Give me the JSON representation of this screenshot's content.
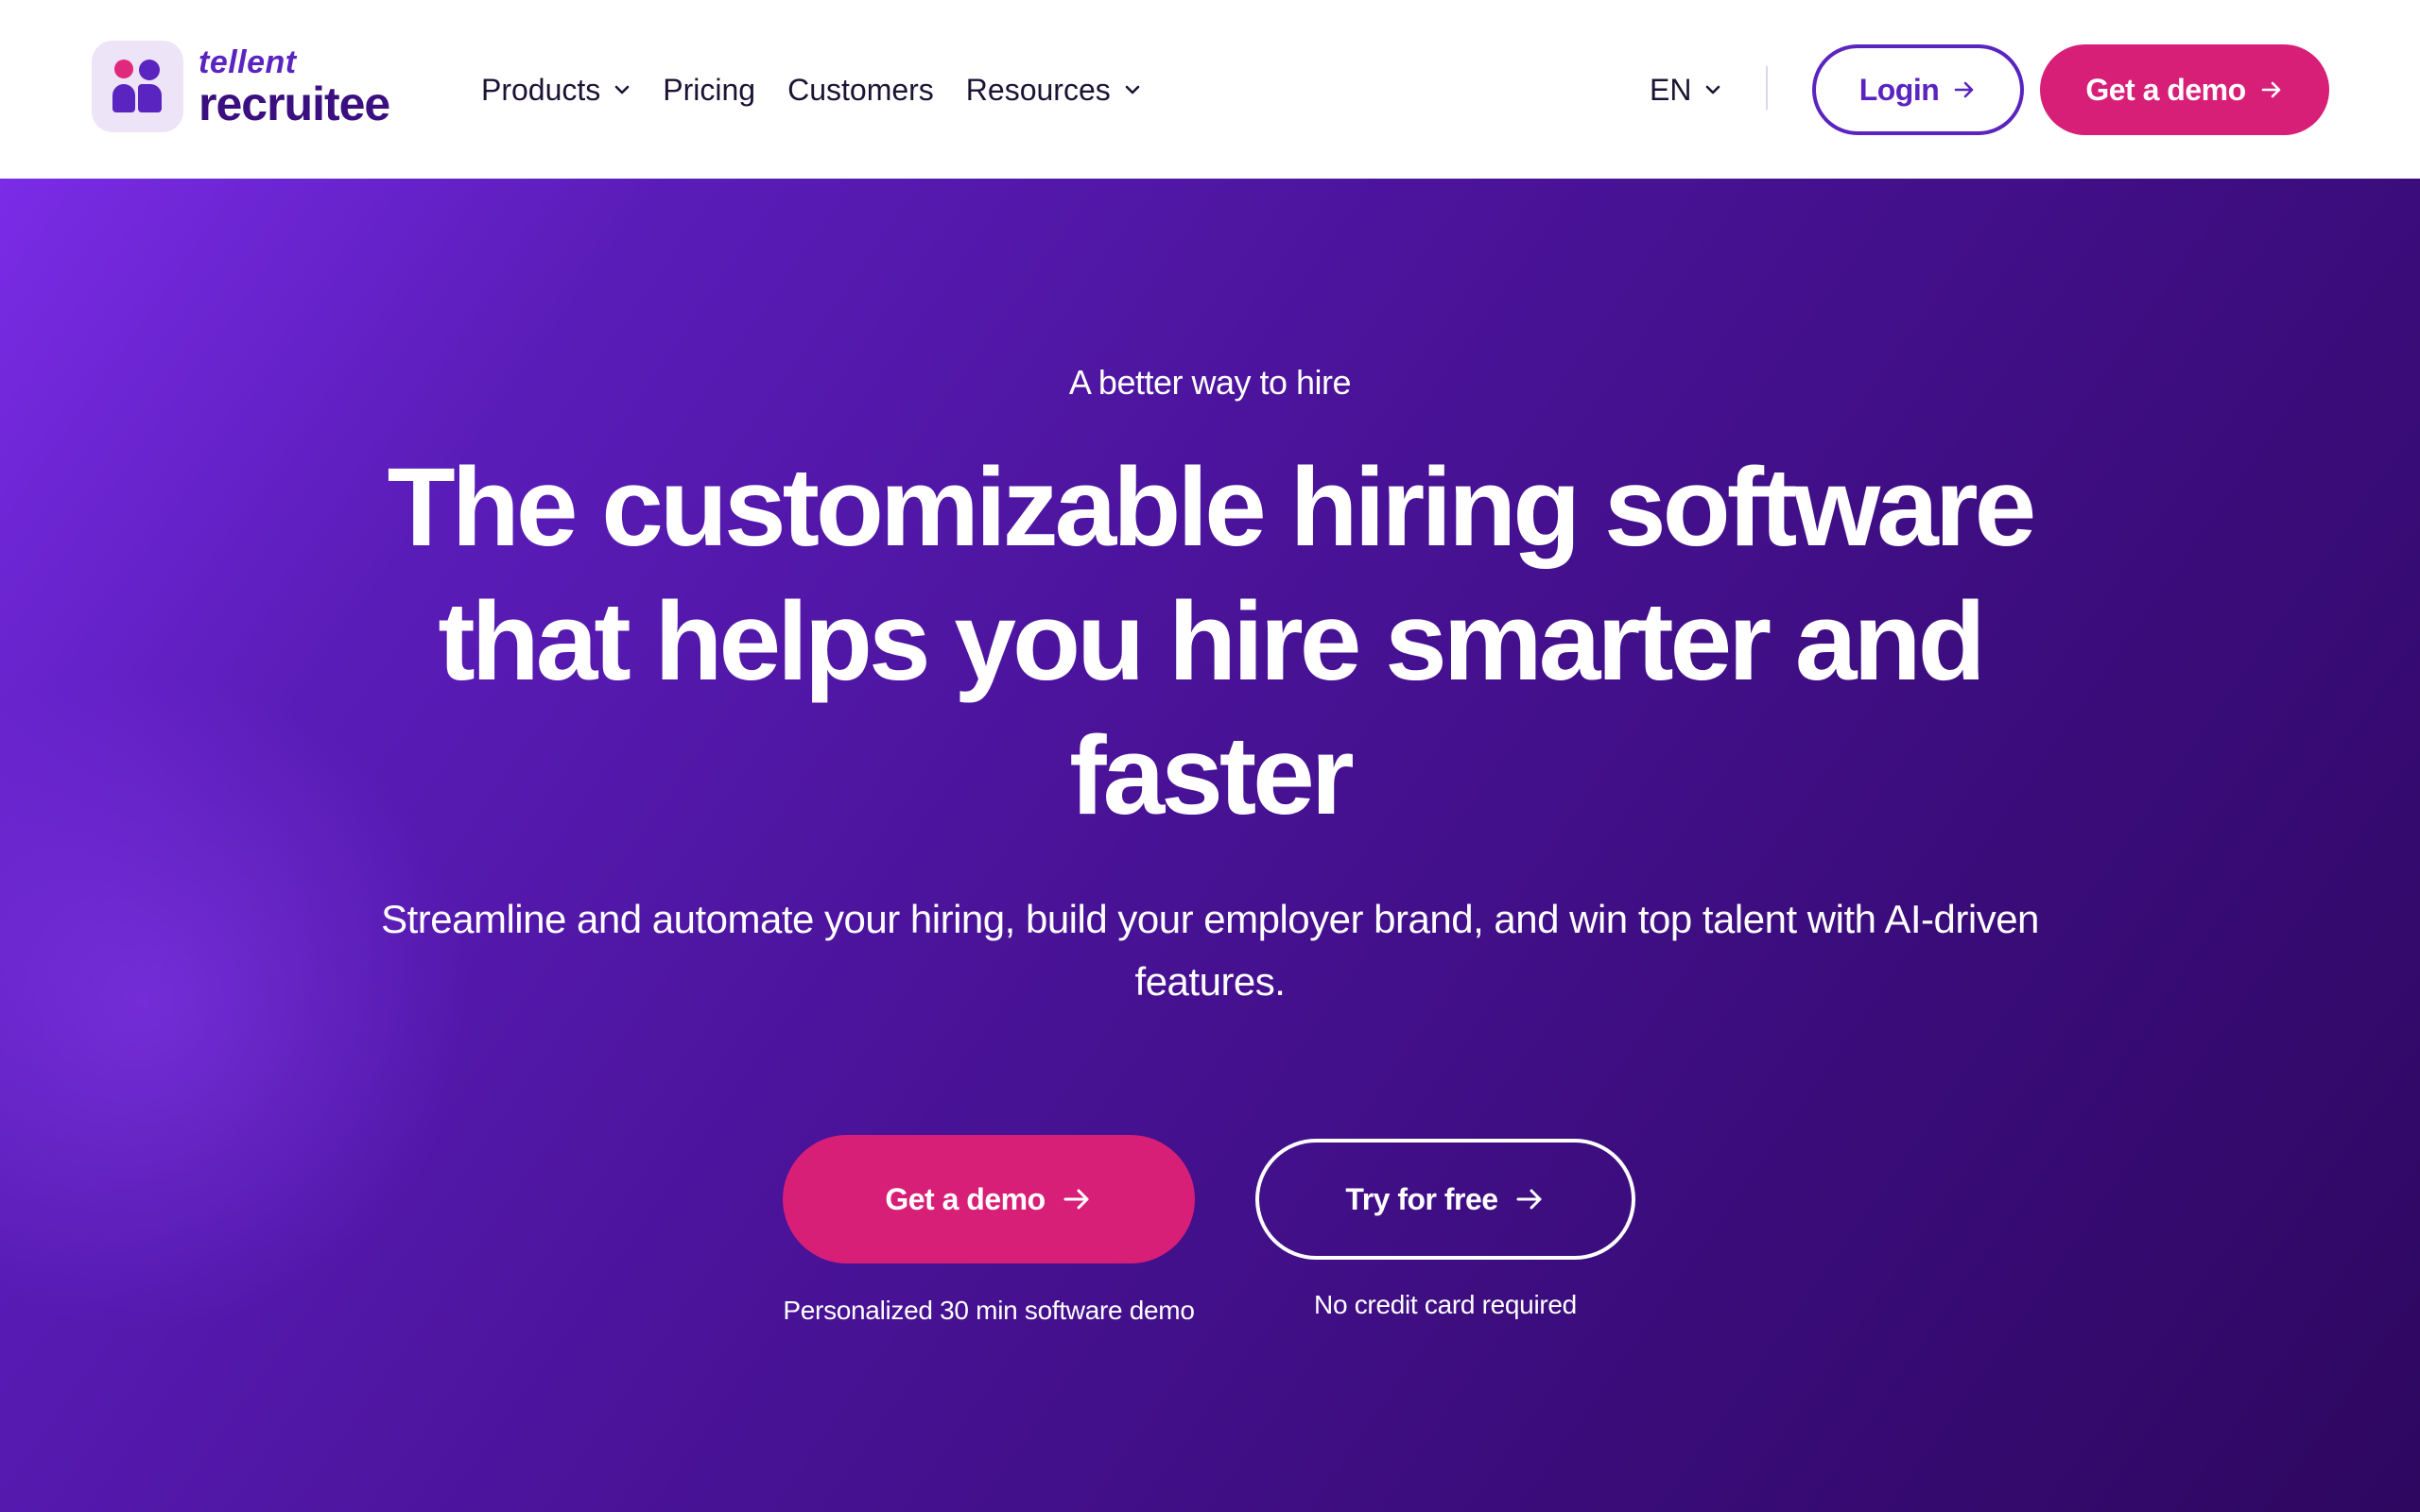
{
  "header": {
    "logo": {
      "top_text": "tellent",
      "bottom_text": "recruitee"
    },
    "nav": [
      {
        "label": "Products",
        "has_dropdown": true
      },
      {
        "label": "Pricing",
        "has_dropdown": false
      },
      {
        "label": "Customers",
        "has_dropdown": false
      },
      {
        "label": "Resources",
        "has_dropdown": true
      }
    ],
    "language": "EN",
    "login_label": "Login",
    "demo_label": "Get a demo"
  },
  "hero": {
    "eyebrow": "A better way to hire",
    "headline": "The customizable hiring software that helps you hire smarter and faster",
    "subheadline": "Streamline and automate your hiring, build your employer brand, and win top talent with AI-driven features.",
    "primary_cta": "Get a demo",
    "primary_caption": "Personalized 30 min software demo",
    "secondary_cta": "Try for free",
    "secondary_caption": "No credit card required"
  },
  "colors": {
    "brand_purple": "#5a24c0",
    "brand_pink": "#d81f78",
    "hero_gradient_start": "#7a2ce6",
    "hero_gradient_end": "#2e0760"
  },
  "icons": [
    "chevron-down-icon",
    "arrow-right-icon"
  ]
}
